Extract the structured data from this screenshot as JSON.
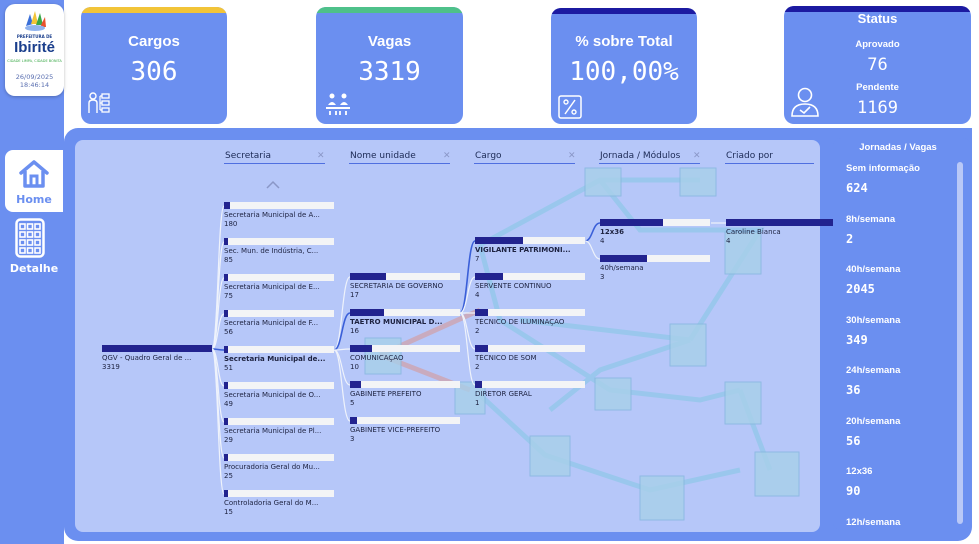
{
  "header": {
    "logo_title": "PREFEITURA DE",
    "logo_name": "Ibirité",
    "logo_slogan": "CIDADE LIMPA, CIDADE BONITA",
    "date": "26/09/2025",
    "time": "18:46:14"
  },
  "nav": {
    "home_label": "Home",
    "detail_label": "Detalhe"
  },
  "kpis": {
    "cargos": {
      "title": "Cargos",
      "value": "306"
    },
    "vagas": {
      "title": "Vagas",
      "value": "3319"
    },
    "percent": {
      "title": "% sobre Total",
      "value": "100,00%"
    }
  },
  "status": {
    "title": "Status",
    "aprovado_label": "Aprovado",
    "aprovado_value": "76",
    "pendente_label": "Pendente",
    "pendente_value": "1169"
  },
  "colors": {
    "panel": "#6b8ff0",
    "visual_bg": "#b6c7f9",
    "bar_fill": "#22238f",
    "accent_cargos": "#f2c438",
    "accent_vagas": "#4ec18a",
    "accent_dark": "#1c1aa1"
  },
  "tree": {
    "headers": {
      "secretaria": "Secretaria",
      "unidade": "Nome unidade",
      "cargo": "Cargo",
      "jornada": "Jornada / Módulos",
      "criado": "Criado por"
    },
    "root": {
      "label": "QGV - Quadro Geral de ...",
      "value": "3319",
      "fraction": 1.0
    },
    "secretarias": [
      {
        "label": "Secretaria Municipal de A...",
        "value": "180",
        "fraction": 0.05
      },
      {
        "label": "Sec. Mun. de Indústria, C...",
        "value": "85",
        "fraction": 0.03
      },
      {
        "label": "Secretaria Municipal de E...",
        "value": "75",
        "fraction": 0.02
      },
      {
        "label": "Secretaria Municipal de F...",
        "value": "56",
        "fraction": 0.02
      },
      {
        "label": "Secretaria Municipal de...",
        "value": "51",
        "fraction": 0.02,
        "selected": true
      },
      {
        "label": "Secretaria Municipal de O...",
        "value": "49",
        "fraction": 0.015
      },
      {
        "label": "Secretaria Municipal de Pl...",
        "value": "29",
        "fraction": 0.01
      },
      {
        "label": "Procuradoria Geral do Mu...",
        "value": "25",
        "fraction": 0.008
      },
      {
        "label": "Controladoria Geral do M...",
        "value": "15",
        "fraction": 0.005
      }
    ],
    "unidades": [
      {
        "label": "SECRETARIA DE GOVERNO",
        "value": "17",
        "fraction": 0.33
      },
      {
        "label": "TAETRO MUNICIPAL D...",
        "value": "16",
        "fraction": 0.31,
        "selected": true
      },
      {
        "label": "COMUNICAÇÃO",
        "value": "10",
        "fraction": 0.2
      },
      {
        "label": "GABINETE PREFEITO",
        "value": "5",
        "fraction": 0.1
      },
      {
        "label": "GABINETE VICE-PREFEITO",
        "value": "3",
        "fraction": 0.06
      }
    ],
    "cargos": [
      {
        "label": "VIGILANTE PATRIMONI...",
        "value": "7",
        "fraction": 0.44,
        "selected": true
      },
      {
        "label": "SERVENTE CONTINUO",
        "value": "4",
        "fraction": 0.25
      },
      {
        "label": "TÉCNICO DE ILUMINAÇÃO",
        "value": "2",
        "fraction": 0.12
      },
      {
        "label": "TÉCNICO DE SOM",
        "value": "2",
        "fraction": 0.12
      },
      {
        "label": "DIRETOR GERAL",
        "value": "1",
        "fraction": 0.06
      }
    ],
    "jornadas": [
      {
        "label": "12x36",
        "value": "4",
        "fraction": 0.57,
        "selected": true
      },
      {
        "label": "40h/semana",
        "value": "3",
        "fraction": 0.43
      }
    ],
    "criados": [
      {
        "label": "Caroline Bianca",
        "value": "4",
        "fraction": 1.0
      }
    ]
  },
  "jornadas_vagas": {
    "title": "Jornadas / Vagas",
    "items": [
      {
        "label": "Sem informação",
        "value": "624"
      },
      {
        "label": "8h/semana",
        "value": "2"
      },
      {
        "label": "40h/semana",
        "value": "2045"
      },
      {
        "label": "30h/semana",
        "value": "349"
      },
      {
        "label": "24h/semana",
        "value": "36"
      },
      {
        "label": "20h/semana",
        "value": "56"
      },
      {
        "label": "12x36",
        "value": "90"
      },
      {
        "label": "12h/semana",
        "value": ""
      }
    ]
  }
}
